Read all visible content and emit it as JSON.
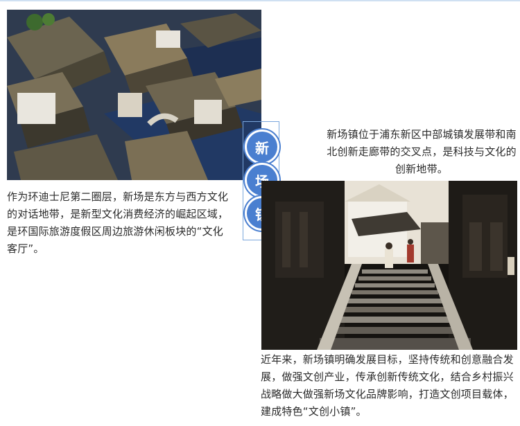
{
  "title_chars": [
    "新",
    "场",
    "镇"
  ],
  "paragraphs": {
    "left": "作为环迪士尼第二圈层，新场是东方与西方文化的对话地带，是新型文化消费经济的崛起区域，是环国际旅游度假区周边旅游休闲板块的“文化客厅”。",
    "right_top": "新场镇位于浦东新区中部城镇发展带和南北创新走廊带的交叉点，是科技与文化的创新地带。",
    "bottom": "近年来，新场镇明确发展目标，坚持传统和创意融合发展，做强文创产业，传承创新传统文化，结合乡村振兴战略做大做强新场文化品牌影响，打造文创项目载体，建成特色“文创小镇”。"
  },
  "colors": {
    "accent": "#4a7fd0",
    "frame": "#7aa6dc",
    "text": "#2a2a2a"
  },
  "images": {
    "aerial": "aerial-rooftops-photo",
    "stairs": "stone-stairs-street-photo"
  }
}
